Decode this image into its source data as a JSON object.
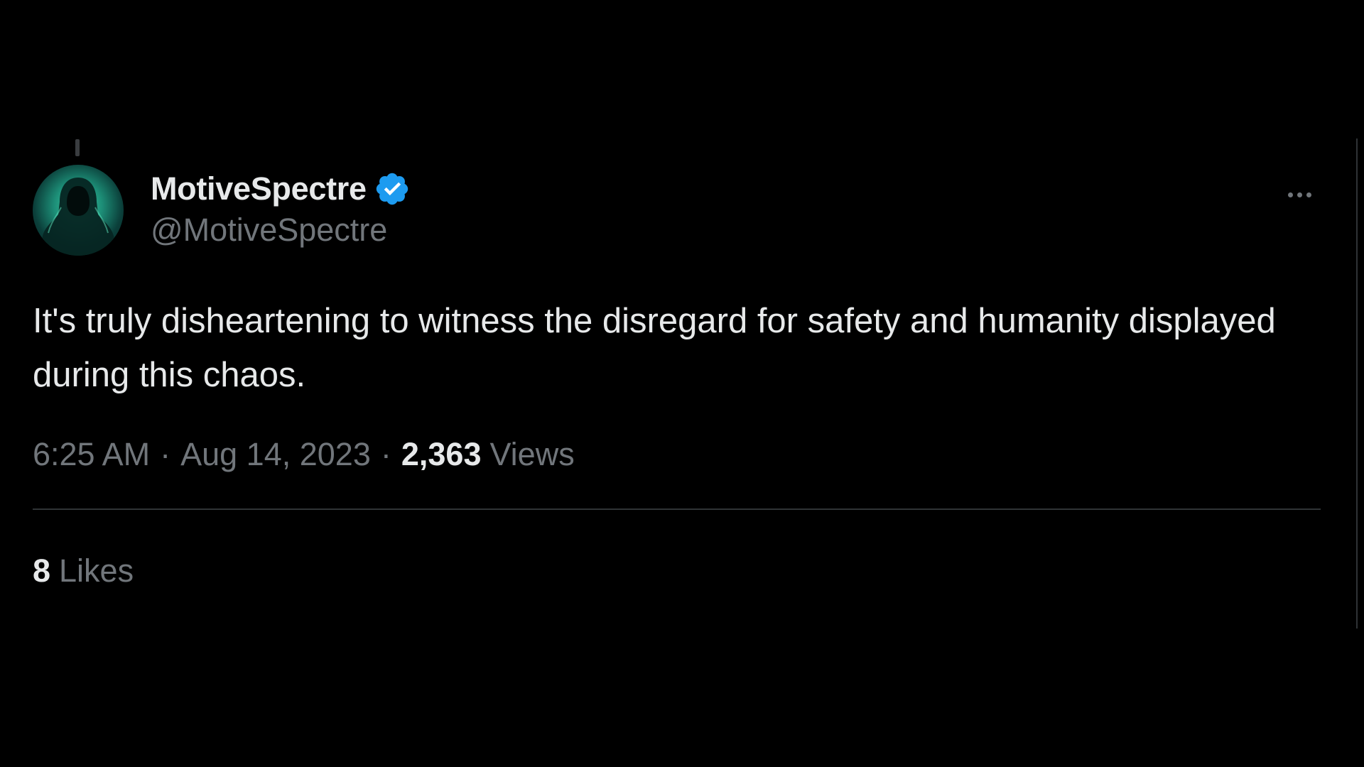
{
  "tweet": {
    "author": {
      "display_name": "MotiveSpectre",
      "handle": "@MotiveSpectre",
      "verified_icon": "verified-badge-icon",
      "verified_color": "#1d9bf0"
    },
    "more_icon": "more-options-icon",
    "text": "It's truly disheartening to witness the disregard for safety and humanity displayed during this chaos.",
    "time": "6:25 AM",
    "date": "Aug 14, 2023",
    "separator": "·",
    "views_count": "2,363",
    "views_label": "Views",
    "likes_count": "8",
    "likes_label": "Likes"
  },
  "colors": {
    "background": "#000000",
    "primary_text": "#e7e9ea",
    "secondary_text": "#71767b",
    "divider": "#2f3336",
    "avatar_glow": "#3fd3a6"
  }
}
